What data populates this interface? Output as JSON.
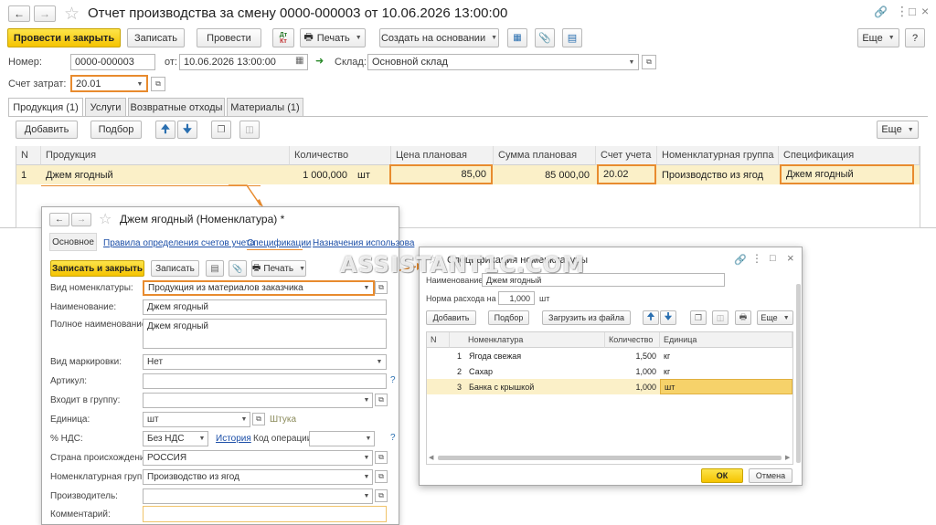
{
  "main": {
    "title": "Отчет производства за смену 0000-000003 от 10.06.2026 13:00:00",
    "toolbar": {
      "post_close": "Провести и закрыть",
      "save": "Записать",
      "post": "Провести",
      "print": "Печать",
      "create_basis": "Создать на основании",
      "more": "Еще"
    },
    "number_label": "Номер:",
    "number_value": "0000-000003",
    "date_label": "от:",
    "date_value": "10.06.2026 13:00:00",
    "warehouse_label": "Склад:",
    "warehouse_value": "Основной склад",
    "account_label": "Счет затрат:",
    "account_value": "20.01",
    "tabs": [
      "Продукция (1)",
      "Услуги",
      "Возвратные отходы",
      "Материалы (1)"
    ],
    "table_toolbar": {
      "add": "Добавить",
      "select": "Подбор",
      "more": "Еще"
    },
    "columns": [
      "N",
      "Продукция",
      "Количество",
      "Цена плановая",
      "Сумма плановая",
      "Счет учета",
      "Номенклатурная группа",
      "Спецификация"
    ],
    "row": {
      "n": "1",
      "product": "Джем ягодный",
      "qty": "1 000,000",
      "unit": "шт",
      "price": "85,00",
      "sum": "85 000,00",
      "account": "20.02",
      "group": "Производство из ягод",
      "spec": "Джем ягодный"
    }
  },
  "nom": {
    "title": "Джем ягодный (Номенклатура) *",
    "nav": [
      "Основное",
      "Правила определения счетов учета",
      "Спецификации",
      "Назначения использова"
    ],
    "toolbar": {
      "save_close": "Записать и закрыть",
      "save": "Записать",
      "print": "Печать"
    },
    "fields": {
      "kind_label": "Вид номенклатуры:",
      "kind_value": "Продукция из материалов заказчика",
      "name_label": "Наименование:",
      "name_value": "Джем ягодный",
      "full_name_label": "Полное наименование:",
      "full_name_value": "Джем ягодный",
      "marking_label": "Вид маркировки:",
      "marking_value": "Нет",
      "article_label": "Артикул:",
      "group_label": "Входит в группу:",
      "unit_label": "Единица:",
      "unit_value": "шт",
      "unit_hint": "Штука",
      "vat_label": "% НДС:",
      "vat_value": "Без НДС",
      "history_link": "История",
      "op_code_label": "Код операции:",
      "country_label": "Страна происхождения:",
      "country_value": "РОССИЯ",
      "nom_group_label": "Номенклатурная группа:",
      "nom_group_value": "Производство из ягод",
      "maker_label": "Производитель:",
      "comment_label": "Комментарий:",
      "help": "?"
    }
  },
  "spec": {
    "title": "Спецификация номенклатуры",
    "name_label": "Наименование:",
    "name_value": "Джем ягодный",
    "norm_label": "Норма расхода на",
    "norm_value": "1,000",
    "norm_unit": "шт",
    "toolbar": {
      "add": "Добавить",
      "select": "Подбор",
      "load": "Загрузить из файла",
      "more": "Еще"
    },
    "columns": [
      "N",
      "Номенклатура",
      "Количество",
      "Единица"
    ],
    "rows": [
      {
        "n": "1",
        "item": "Ягода свежая",
        "qty": "1,500",
        "unit": "кг"
      },
      {
        "n": "2",
        "item": "Сахар",
        "qty": "1,000",
        "unit": "кг"
      },
      {
        "n": "3",
        "item": "Банка с крышкой",
        "qty": "1,000",
        "unit": "шт"
      }
    ],
    "ok": "ОК",
    "cancel": "Отмена"
  },
  "watermark": "ASSISTANT1C.COM",
  "colors": {
    "accent_yellow": "#f5c300",
    "highlight_orange": "#e88b2e",
    "selected_row": "#fbf0c8",
    "link_blue": "#1c4fa8"
  }
}
